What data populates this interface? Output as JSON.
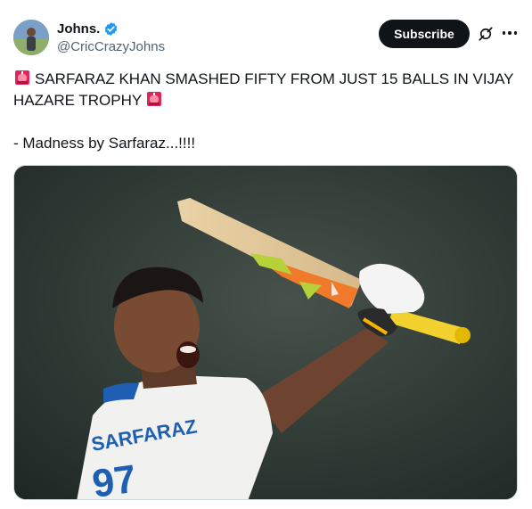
{
  "author": {
    "display_name": "Johns.",
    "handle": "@CricCrazyJohns"
  },
  "actions": {
    "subscribe_label": "Subscribe"
  },
  "post": {
    "line1": "SARFARAZ KHAN SMASHED FIFTY FROM JUST 15 BALLS IN VIJAY",
    "line2": "HAZARE TROPHY",
    "line3": "- Madness by Sarfaraz...!!!!"
  },
  "media": {
    "jersey_text": "SARFARAZ",
    "jersey_number": "97"
  },
  "icons": {
    "verified": "verified-badge-icon",
    "grok": "grok-icon",
    "more": "more-options-icon",
    "siren": "police-light-emoji"
  },
  "colors": {
    "verified_blue": "#1d9bf0",
    "subscribe_bg": "#0f1419",
    "handle_gray": "#536471"
  }
}
